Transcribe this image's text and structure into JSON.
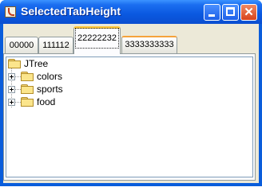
{
  "window": {
    "title": "SelectedTabHeight"
  },
  "tabs": [
    {
      "label": "00000",
      "selected": false
    },
    {
      "label": "111112",
      "selected": false
    },
    {
      "label": "22222232",
      "selected": true
    },
    {
      "label": "3333333333",
      "selected": false,
      "hover": true
    }
  ],
  "tree": {
    "root": "JTree",
    "children": [
      {
        "label": "colors"
      },
      {
        "label": "sports"
      },
      {
        "label": "food"
      }
    ]
  },
  "colors": {
    "titlebar": "#0a58e0",
    "selected_tab_accent": "#ffc83c",
    "folder": "#fbe58c"
  }
}
